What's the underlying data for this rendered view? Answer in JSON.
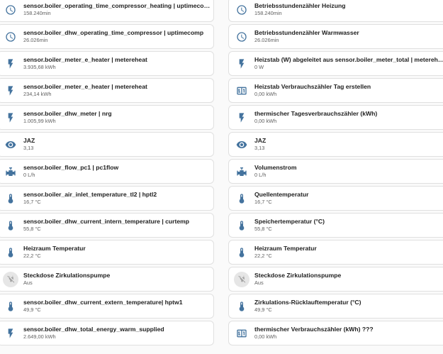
{
  "left_column": [
    {
      "icon": "timer-icon",
      "name": "sensor.boiler_operating_time_compressor_heating | uptimecomph...",
      "state": "158.240min"
    },
    {
      "icon": "timer-icon",
      "name": "sensor.boiler_dhw_operating_time_compressor | uptimecomp",
      "state": "26.026min"
    },
    {
      "icon": "flash-icon",
      "name": "sensor.boiler_meter_e_heater | metereheat",
      "state": "3.935,68 kWh"
    },
    {
      "icon": "flash-icon",
      "name": "sensor.boiler_meter_e_heater | metereheat",
      "state": "234,14 kWh"
    },
    {
      "icon": "flash-icon",
      "name": "sensor.boiler_dhw_meter | nrg",
      "state": "1.005,99 kWh"
    },
    {
      "icon": "eye-icon",
      "name": "JAZ",
      "state": "3,13"
    },
    {
      "icon": "valve-icon",
      "name": "sensor.boiler_flow_pc1 | pc1flow",
      "state": "0 L/h"
    },
    {
      "icon": "thermometer-icon",
      "name": "sensor.boiler_air_inlet_temperature_tl2 | hptl2",
      "state": "16,7 °C"
    },
    {
      "icon": "thermometer-icon",
      "name": "sensor.boiler_dhw_current_intern_temperature | curtemp",
      "state": "55,8 °C"
    },
    {
      "icon": "thermometer-icon",
      "name": "Heizraum Temperatur",
      "state": "22,2 °C"
    },
    {
      "icon": "power-plug-off-icon",
      "name": "Steckdose Zirkulationspumpe",
      "state": "Aus"
    },
    {
      "icon": "thermometer-icon",
      "name": "sensor.boiler_dhw_current_extern_temperature| hptw1",
      "state": "49,9 °C"
    },
    {
      "icon": "flash-icon",
      "name": "sensor.boiler_dhw_total_energy_warm_supplied",
      "state": "2.649,00 kWh"
    }
  ],
  "right_column": [
    {
      "icon": "timer-icon",
      "name": "Betriebsstundenzähler Heizung",
      "state": "158.240min"
    },
    {
      "icon": "timer-icon",
      "name": "Betriebsstundenzähler Warmwasser",
      "state": "26.026min"
    },
    {
      "icon": "flash-icon",
      "name": "Heizstab (W) abgeleitet aus sensor.boiler_meter_total | metereheat",
      "state": "0 W"
    },
    {
      "icon": "counter-icon",
      "name": "Heizstab Verbrauchszähler Tag erstellen",
      "state": "0,00 kWh"
    },
    {
      "icon": "flash-icon",
      "name": "thermischer Tagesverbrauchszähler (kWh)",
      "state": "0,00 kWh"
    },
    {
      "icon": "eye-icon",
      "name": "JAZ",
      "state": "3,13"
    },
    {
      "icon": "valve-icon",
      "name": "Volumenstrom",
      "state": "0 L/h"
    },
    {
      "icon": "thermometer-icon",
      "name": "Quellentemperatur",
      "state": "16,7 °C"
    },
    {
      "icon": "thermometer-icon",
      "name": "Speichertemperatur (°C)",
      "state": "55,8 °C"
    },
    {
      "icon": "thermometer-icon",
      "name": "Heizraum Temperatur",
      "state": "22,2 °C"
    },
    {
      "icon": "power-plug-off-icon",
      "name": "Steckdose Zirkulationspumpe",
      "state": "Aus"
    },
    {
      "icon": "thermometer-icon",
      "name": "Zirkulations-Rücklauftemperatur (°C)",
      "state": "49,9 °C"
    },
    {
      "icon": "counter-icon",
      "name": "thermischer Verbrauchszähler (kWh) ???",
      "state": "0,00 kWh"
    }
  ],
  "colors": {
    "icon": "#44739e",
    "icon_off": "#9e9e9e",
    "card_bg": "#ffffff",
    "page_bg": "#fafafa",
    "border": "#e0e0e0"
  }
}
